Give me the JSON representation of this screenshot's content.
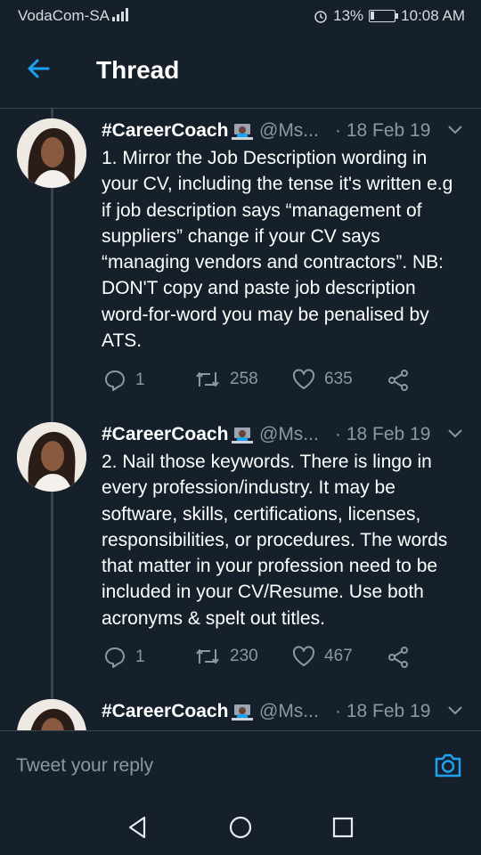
{
  "status": {
    "carrier": "VodaCom-SA",
    "battery": "13%",
    "time": "10:08 AM"
  },
  "header": {
    "title": "Thread"
  },
  "tweets": [
    {
      "name": "#CareerCoach",
      "handle": "@Ms...",
      "date": "· 18 Feb 19",
      "text": "1. Mirror the Job Description wording in your CV, including the tense it's written e.g if job description says “management of suppliers” change if your CV says “managing vendors and contractors”. NB: DON'T copy and paste job description word-for-word you may be penalised by ATS.",
      "replies": "1",
      "retweets": "258",
      "likes": "635"
    },
    {
      "name": "#CareerCoach",
      "handle": "@Ms...",
      "date": "· 18 Feb 19",
      "text": "2. Nail those keywords. There is lingo in every profession/industry. It may be software, skills, certifications, licenses, responsibilities, or procedures. The words that matter in your profession need to be included in your CV/Resume. Use both acronyms & spelt out titles.",
      "replies": "1",
      "retweets": "230",
      "likes": "467"
    },
    {
      "name": "#CareerCoach",
      "handle": "@Ms...",
      "date": "· 18 Feb 19"
    }
  ],
  "reply": {
    "placeholder": "Tweet your reply"
  },
  "colors": {
    "background": "#15202b",
    "accent": "#1da1f2",
    "secondary_text": "#8899a6",
    "divider": "#38444d"
  },
  "icons": [
    "back-arrow-icon",
    "technologist-emoji-icon",
    "chevron-down-icon",
    "reply-icon",
    "retweet-icon",
    "like-icon",
    "share-icon",
    "camera-icon",
    "nav-back-icon",
    "nav-home-icon",
    "nav-recents-icon"
  ]
}
